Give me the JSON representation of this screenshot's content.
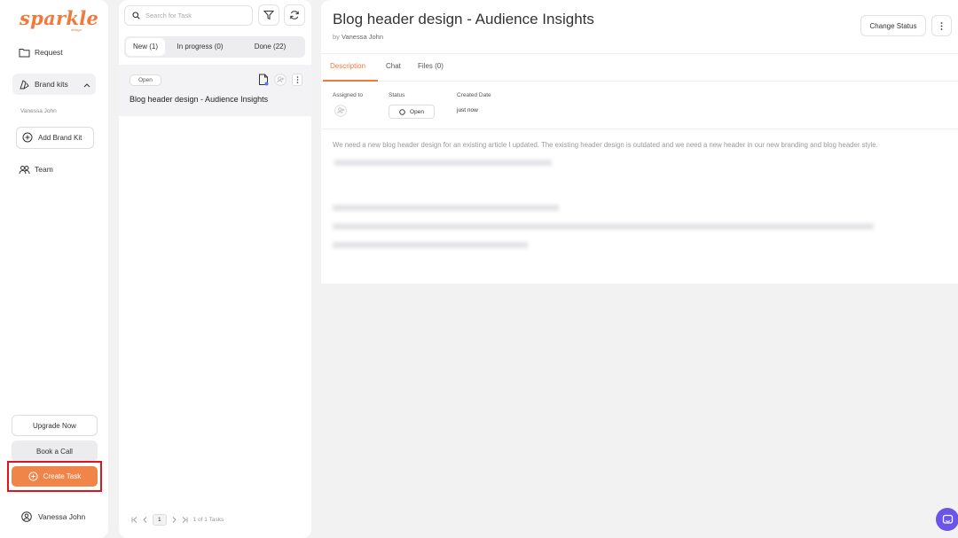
{
  "app": {
    "logo": "sparkle",
    "logo_sub": "design",
    "accent": "#f07a3b",
    "highlight": "#e0141e"
  },
  "sidebar": {
    "request_label": "Request",
    "brand_kits_label": "Brand kits",
    "workspace_name": "Vanessa John",
    "add_brand_kit_label": "Add Brand Kit",
    "team_label": "Team",
    "upgrade_label": "Upgrade Now",
    "book_call_label": "Book a Call",
    "create_task_label": "Create Task",
    "user_name": "Vanessa John"
  },
  "tasks": {
    "search_placeholder": "Search for Task",
    "tabs": [
      {
        "label": "New (1)",
        "selected": true
      },
      {
        "label": "In progress (0)",
        "selected": false
      },
      {
        "label": "Done (22)",
        "selected": false
      }
    ],
    "card": {
      "status": "Open",
      "title": "Blog header design - Audience Insights"
    },
    "pager": {
      "page": "1",
      "summary": "1 of 1 Tasks"
    }
  },
  "detail": {
    "title": "Blog header design - Audience Insights",
    "by_prefix": "by",
    "by_name": "Vanessa John",
    "change_status_label": "Change Status",
    "tabs": [
      "Description",
      "Chat",
      "Files (0)"
    ],
    "meta": {
      "assigned_label": "Assigned to",
      "status_label": "Status",
      "status_value": "Open",
      "created_label": "Created Date",
      "created_value": "just now"
    },
    "description": "We need a new blog header design for an existing article I updated. The existing header design is outdated and we need a new header in our new branding and blog header style."
  }
}
